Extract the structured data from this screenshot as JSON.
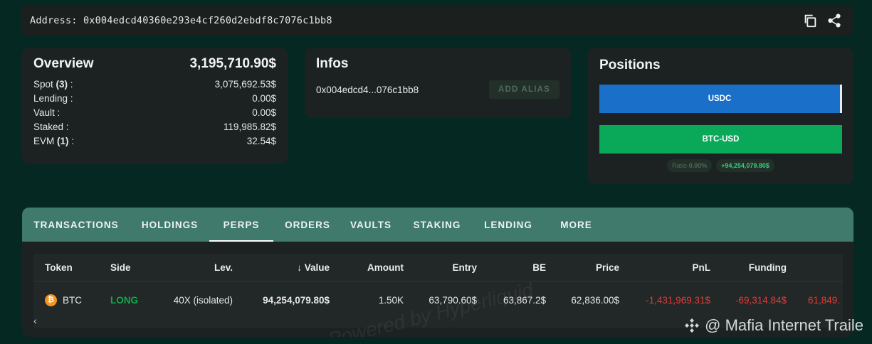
{
  "address_bar": {
    "label": "Address: 0x004edcd40360e293e4cf260d2ebdf8c7076c1bb8",
    "icons": [
      "copy-icon",
      "share-icon"
    ]
  },
  "overview": {
    "title": "Overview",
    "total": "3,195,710.90$",
    "rows": [
      {
        "label": "Spot ",
        "count": "(3)",
        "suffix": " :",
        "value": "3,075,692.53$"
      },
      {
        "label": "Lending :",
        "count": "",
        "suffix": "",
        "value": "0.00$"
      },
      {
        "label": "Vault :",
        "count": "",
        "suffix": "",
        "value": "0.00$"
      },
      {
        "label": "Staked :",
        "count": "",
        "suffix": "",
        "value": "119,985.82$"
      },
      {
        "label": "EVM ",
        "count": "(1)",
        "suffix": " :",
        "value": "32.54$"
      }
    ]
  },
  "infos": {
    "title": "Infos",
    "short_address": "0x004edcd4...076c1bb8",
    "alias_button": "ADD ALIAS"
  },
  "positions": {
    "title": "Positions",
    "bars": [
      {
        "label": "USDC",
        "color": "#1a70c9"
      },
      {
        "label": "BTC-USD",
        "color": "#0aa95a"
      }
    ],
    "ratio_label": "Ratio",
    "ratio_value": "0.00%",
    "pnl": "+94,254,079.80$"
  },
  "tabs": [
    {
      "label": "TRANSACTIONS",
      "active": false
    },
    {
      "label": "HOLDINGS",
      "active": false
    },
    {
      "label": "PERPS",
      "active": true
    },
    {
      "label": "ORDERS",
      "active": false
    },
    {
      "label": "VAULTS",
      "active": false
    },
    {
      "label": "STAKING",
      "active": false
    },
    {
      "label": "LENDING",
      "active": false
    },
    {
      "label": "MORE",
      "active": false
    }
  ],
  "table": {
    "headers": [
      "Token",
      "Side",
      "Lev.",
      "↓ Value",
      "Amount",
      "Entry",
      "BE",
      "Price",
      "PnL",
      "Funding",
      ""
    ],
    "row": {
      "token": "BTC",
      "side": "LONG",
      "lev": "40X (isolated)",
      "value": "94,254,079.80$",
      "amount": "1.50K",
      "entry": "63,790.60$",
      "be": "63,867.2$",
      "price": "62,836.00$",
      "pnl": "-1,431,969.31$",
      "funding": "-69,314.84$",
      "extra": "61,849."
    },
    "table_watermark": "Powered by Hyperliquid",
    "scroll_left": "‹"
  },
  "watermark": "@ Mafia Internet Traile"
}
